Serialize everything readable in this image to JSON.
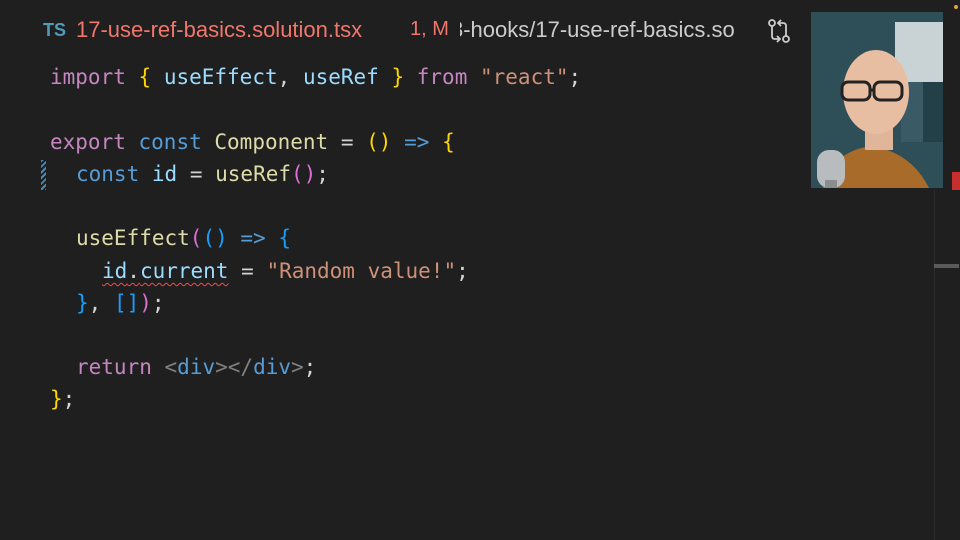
{
  "tab": {
    "language_badge": "TS",
    "filename": "17-use-ref-basics.solution.tsx",
    "status": "1, M",
    "breadcrumb": "3-hooks/17-use-ref-basics.so",
    "compare_icon": "git-compare-icon"
  },
  "code": {
    "line1": {
      "kw_import": "import",
      "b_open": "{",
      "a": "useEffect",
      "comma": ",",
      "b": "useRef",
      "b_close": "}",
      "kw_from": "from",
      "src": "\"react\"",
      "semi": ";"
    },
    "line3": {
      "kw_export": "export",
      "kw_const": "const",
      "name": "Component",
      "eq": "=",
      "paren": "()",
      "arrow": "=>",
      "brace": "{"
    },
    "line4": {
      "kw_const": "const",
      "name": "id",
      "eq": "=",
      "fn": "useRef",
      "paren": "()",
      "semi": ";"
    },
    "line6": {
      "fn": "useEffect",
      "p_open": "(",
      "paren": "()",
      "arrow": "=>",
      "brace": "{"
    },
    "line7": {
      "obj": "id",
      "dot": ".",
      "prop": "current",
      "eq": "=",
      "str": "\"Random value!\"",
      "semi": ";"
    },
    "line8": {
      "brace": "}",
      "comma": ",",
      "arr": "[]",
      "p_close": ")",
      "semi": ";"
    },
    "line10": {
      "kw_return": "return",
      "lt1": "<",
      "tag1": "div",
      "gt1": ">",
      "lt2": "</",
      "tag2": "div",
      "gt2": ">",
      "semi": ";"
    },
    "line11": {
      "brace": "}",
      "semi": ";"
    }
  },
  "webcam": {
    "icon": "webcam-presenter-icon"
  },
  "colors": {
    "error": "#f14c4c",
    "tab_title": "#f1766b",
    "ts_badge": "#519aba"
  }
}
